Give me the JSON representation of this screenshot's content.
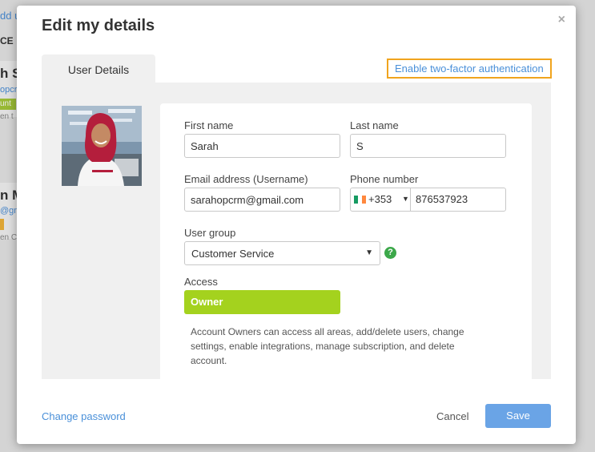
{
  "background": {
    "add_link": "dd u",
    "section_label": "CE",
    "user1": {
      "name": "h S",
      "email": "opcr",
      "badge": "unt",
      "sub": "en t"
    },
    "user2": {
      "name": "n M",
      "email": "@gm",
      "sub": "en C"
    }
  },
  "modal": {
    "title": "Edit my details",
    "close": "×",
    "tab_label": "User Details",
    "twofa_link": "Enable two-factor authentication"
  },
  "form": {
    "first_name_label": "First name",
    "first_name_value": "Sarah",
    "last_name_label": "Last name",
    "last_name_value": "S",
    "email_label": "Email address (Username)",
    "email_value": "sarahopcrm@gmail.com",
    "phone_label": "Phone number",
    "phone_dial_code": "+353",
    "phone_number": "876537923",
    "user_group_label": "User group",
    "user_group_value": "Customer Service",
    "help_icon": "?",
    "access_label": "Access",
    "access_value": "Owner",
    "access_description": "Account Owners can access all areas, add/delete users, change settings, enable integrations, manage subscription, and delete account."
  },
  "footer": {
    "change_password": "Change password",
    "cancel": "Cancel",
    "save": "Save"
  },
  "icons": {
    "close": "close-icon",
    "flag": "ireland-flag-icon",
    "caret": "chevron-down-icon",
    "help": "help-icon"
  },
  "colors": {
    "accent_blue": "#4a90d9",
    "save_button": "#6aa4e6",
    "access_green": "#a4d21e",
    "highlight_orange": "#f0a41e",
    "help_green": "#3ca84a"
  }
}
